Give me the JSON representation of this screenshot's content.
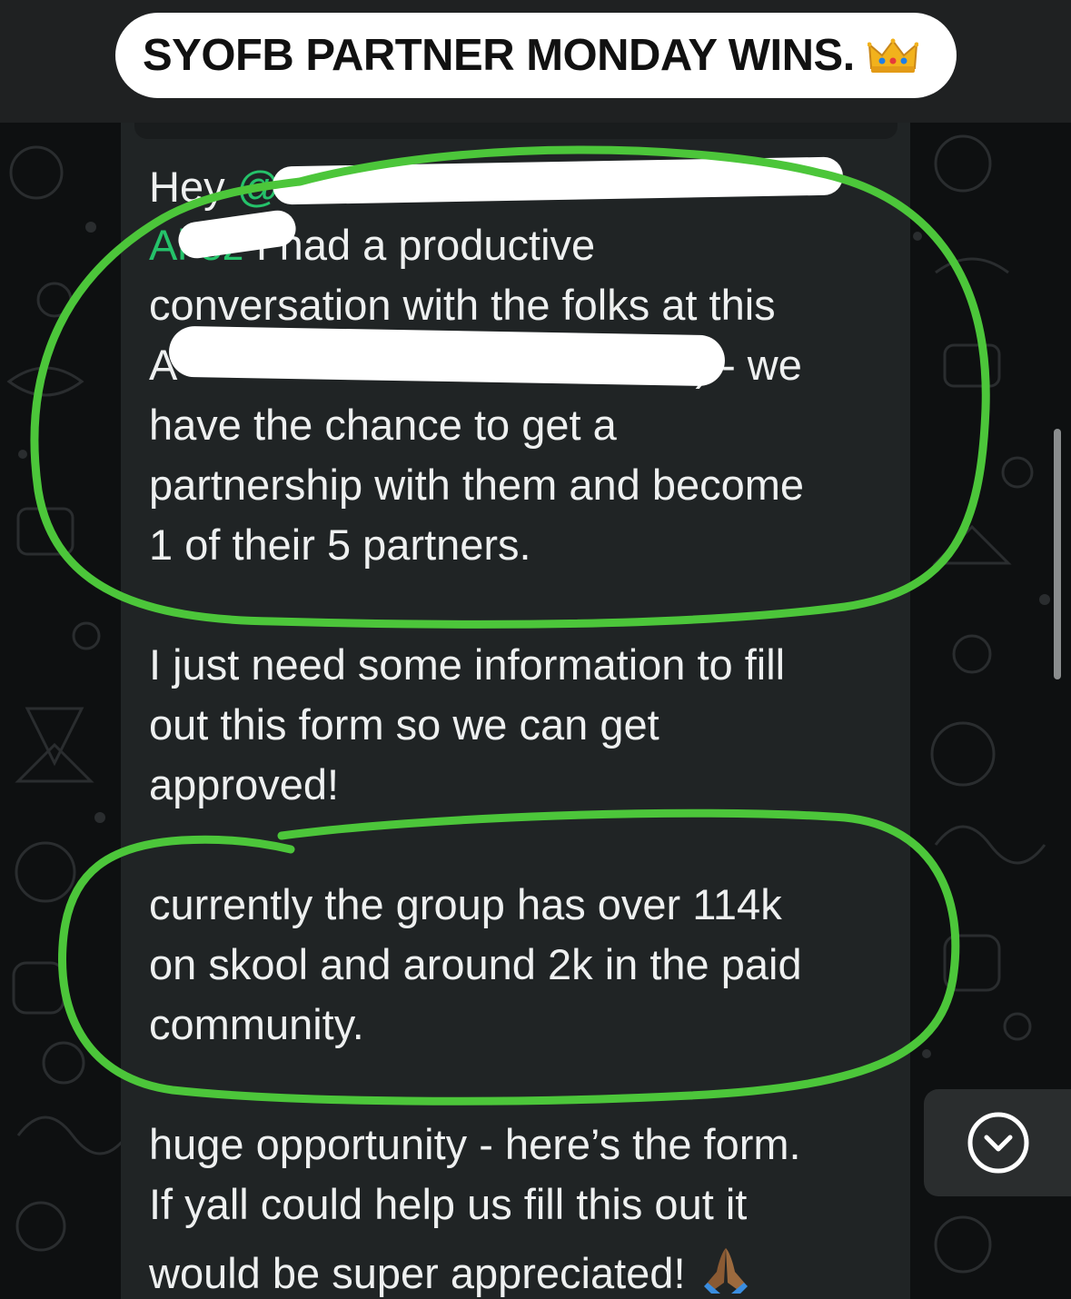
{
  "header": {
    "title": "SYOFB PARTNER MONDAY WINS.",
    "title_emoji": "crown-emoji"
  },
  "message": {
    "lines": [
      {
        "prefix": "Hey",
        "mention": "@K",
        "after": ""
      },
      {
        "mention": "Al    ez",
        "after": " I had a productive"
      },
      {
        "text": "conversation with the folks at this"
      },
      {
        "prefix": "A",
        "after": ") - we"
      },
      {
        "text": "have the chance to get a"
      },
      {
        "text": "partnership with them and become"
      },
      {
        "text": "1 of their 5 partners."
      },
      {
        "text": "I just need some information to fill"
      },
      {
        "text": "out this form so we can get"
      },
      {
        "text": "approved!"
      },
      {
        "text": "currently the group has over 114k"
      },
      {
        "text": "on skool and around 2k in the paid"
      },
      {
        "text": "community."
      },
      {
        "text": "huge opportunity - here’s the form."
      },
      {
        "text": "If yall could help us fill this out it"
      },
      {
        "text": "would be super appreciated!"
      }
    ],
    "end_emoji": "folded-hands-emoji"
  },
  "controls": {
    "scroll_down_icon": "chevron-down-circle-icon"
  },
  "colors": {
    "background": "#0e1011",
    "bubble": "#202425",
    "text": "#eef0f0",
    "mention": "#25c26a",
    "highlight": "#4cc63a"
  }
}
